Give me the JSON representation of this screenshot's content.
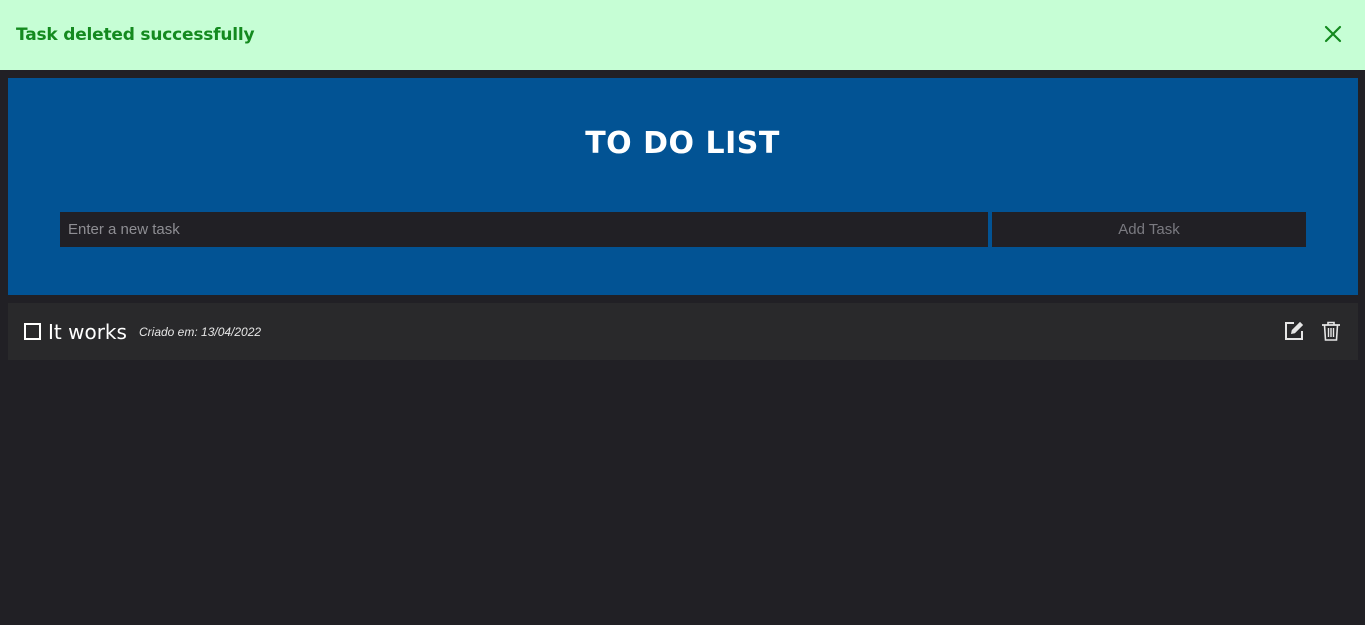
{
  "toast": {
    "message": "Task deleted successfully",
    "close_icon": "close-icon"
  },
  "header": {
    "title": "TO DO LIST",
    "input_placeholder": "Enter a new task",
    "input_value": "",
    "add_button_label": "Add Task"
  },
  "tasks": [
    {
      "text": "It works",
      "created": "Criado em: 13/04/2022",
      "checked": false,
      "edit_icon": "edit-icon",
      "delete_icon": "trash-icon"
    }
  ],
  "colors": {
    "toast_bg": "#c6fed5",
    "toast_text": "#148a1f",
    "header_bg": "#025394",
    "page_bg": "#212025",
    "task_bg": "#29292b"
  }
}
